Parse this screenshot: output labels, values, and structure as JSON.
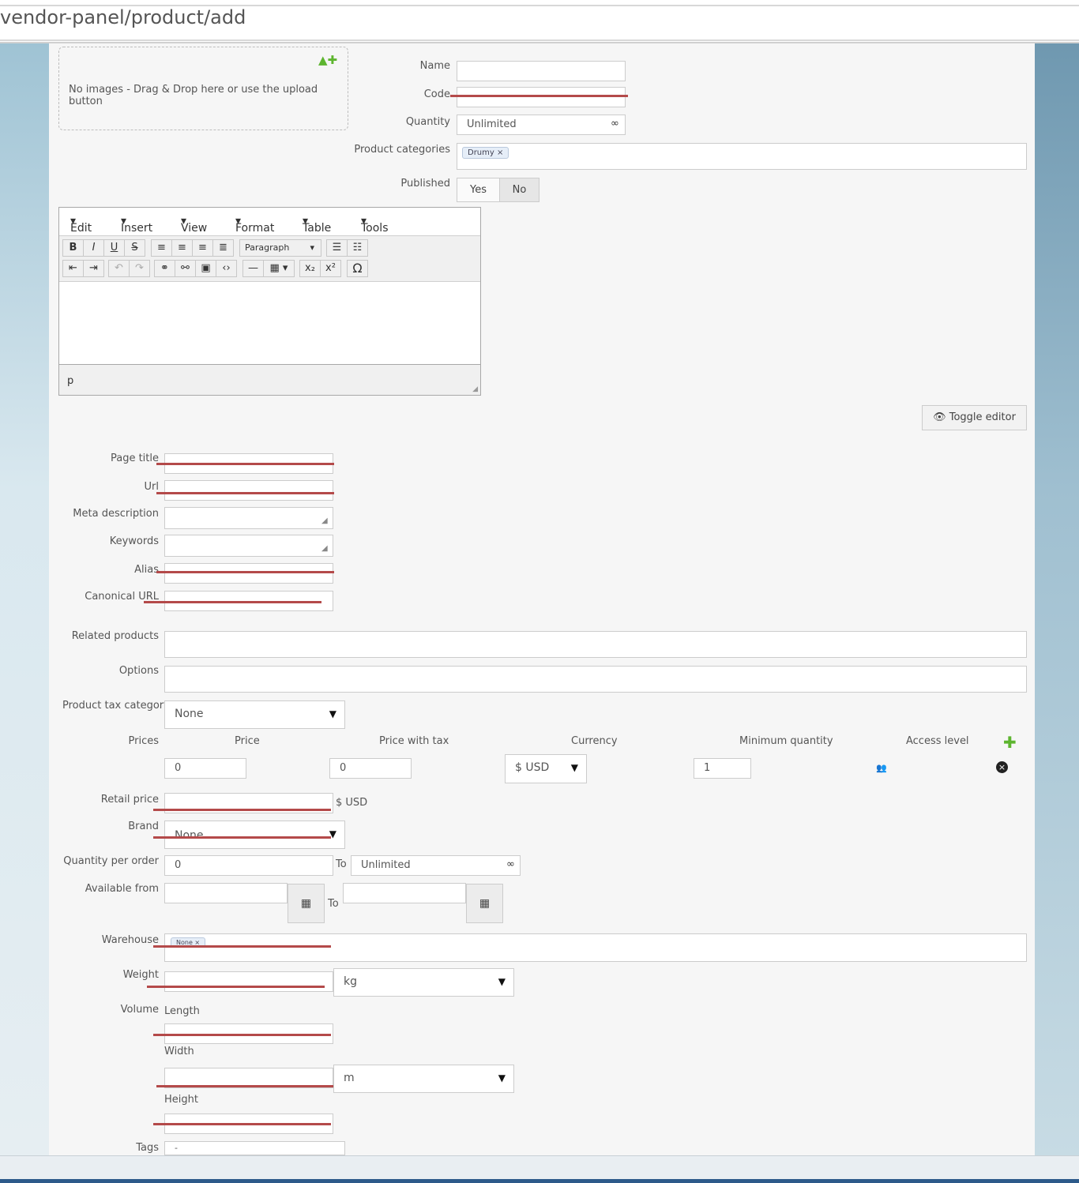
{
  "browser": {
    "url": "vendor-panel/product/add"
  },
  "images": {
    "dropzone_text": "No images - Drag & Drop here or use the upload button"
  },
  "form": {
    "name": {
      "label": "Name",
      "value": ""
    },
    "code": {
      "label": "Code",
      "value": ""
    },
    "quantity": {
      "label": "Quantity",
      "value": "Unlimited"
    },
    "categories": {
      "label": "Product categories",
      "tags": [
        "Drumy"
      ]
    },
    "published": {
      "label": "Published",
      "yes": "Yes",
      "no": "No"
    }
  },
  "editor": {
    "menu": [
      "Edit",
      "Insert",
      "View",
      "Format",
      "Table",
      "Tools"
    ],
    "format_select": "Paragraph",
    "status_path": "p",
    "toggle_label": "Toggle editor"
  },
  "seo": {
    "page_title": "Page title",
    "url": "Url",
    "meta_description": "Meta description",
    "keywords": "Keywords",
    "alias": "Alias",
    "canonical_url": "Canonical URL"
  },
  "relations": {
    "related_products": "Related products",
    "options": "Options"
  },
  "tax": {
    "label": "Product tax category",
    "value": "None"
  },
  "prices": {
    "label": "Prices",
    "columns": [
      "Price",
      "Price with tax",
      "Currency",
      "Minimum quantity",
      "Access level"
    ],
    "row": {
      "price": "0",
      "price_with_tax": "0",
      "currency": "$ USD",
      "min_qty": "1"
    }
  },
  "retail": {
    "label": "Retail price",
    "currency": "$ USD"
  },
  "brand": {
    "label": "Brand",
    "value": "None"
  },
  "qty_per_order": {
    "label": "Quantity per order",
    "from": "0",
    "to_label": "To",
    "to": "Unlimited"
  },
  "available": {
    "label": "Available from",
    "to_label": "To"
  },
  "warehouse": {
    "label": "Warehouse",
    "tags": [
      "None"
    ]
  },
  "weight": {
    "label": "Weight",
    "unit": "kg"
  },
  "volume": {
    "label": "Volume",
    "length": "Length",
    "width": "Width",
    "height": "Height",
    "unit": "m"
  },
  "tags": {
    "label": "Tags",
    "value": "-"
  }
}
